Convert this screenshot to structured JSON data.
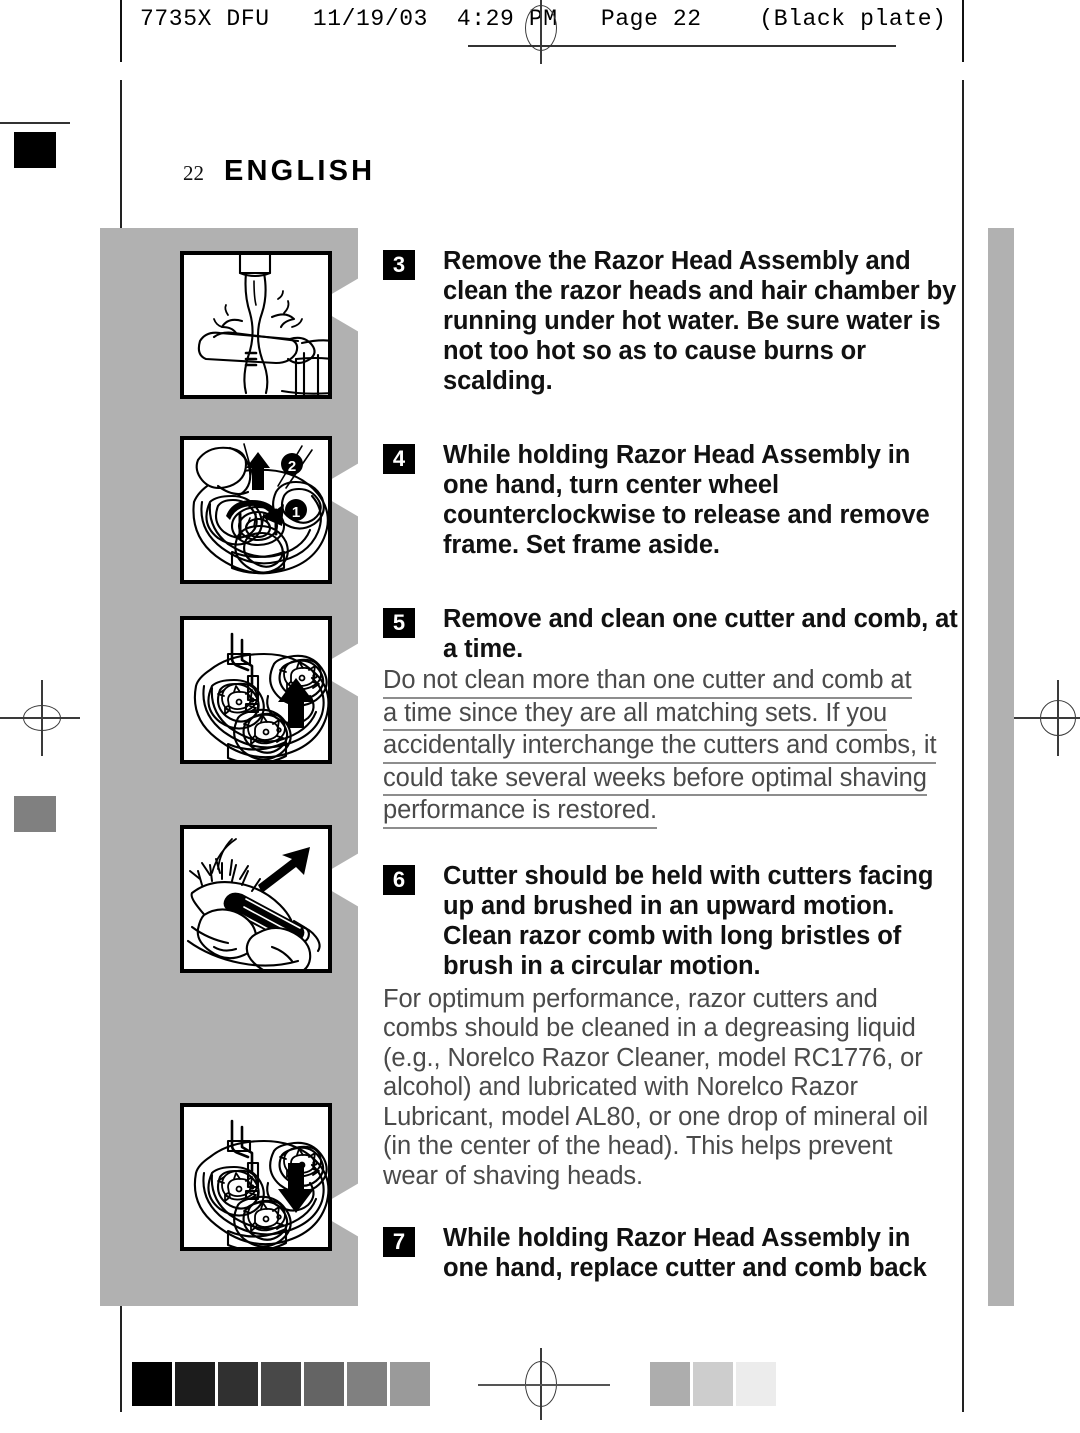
{
  "print_header": {
    "text": "7735X DFU   11/19/03  4:29 PM   Page 22    (Black plate)"
  },
  "page": {
    "folio": "22",
    "language_title": "ENGLISH"
  },
  "steps": [
    {
      "number": "3",
      "emphasis": "bold",
      "text": "Remove the Razor Head Assembly and clean the razor heads and hair chamber by running under hot water. Be sure water is not too hot so as to cause burns or scalding."
    },
    {
      "number": "4",
      "emphasis": "bold",
      "text": "While holding Razor Head Assembly in one hand, turn center wheel counterclockwise to release and remove frame. Set frame aside."
    },
    {
      "number": "5",
      "emphasis": "bold",
      "text": "Remove and clean one cutter and comb, at a time."
    },
    {
      "number": "6",
      "emphasis": "bold",
      "text": "Cutter should be held with cutters facing up and brushed in an upward motion. Clean razor comb with long bristles of brush in a circular motion."
    },
    {
      "number": "7",
      "emphasis": "bold",
      "text": "While holding Razor Head Assembly in one hand, replace cutter and comb back"
    }
  ],
  "step_lines": {
    "s3": [
      "Remove the Razor Head Assembly and",
      "clean the razor heads and hair chamber by",
      "running under hot water. Be sure water is",
      "not too hot so as to cause burns or",
      "scalding."
    ],
    "s4": [
      "While holding Razor Head Assembly in",
      "one hand, turn center wheel",
      "counterclockwise to release and remove",
      "frame. Set frame aside."
    ],
    "s5": [
      "Remove and clean one cutter and comb, at",
      "a time."
    ],
    "s6": [
      "Cutter should be held with cutters facing",
      "up and brushed in an upward motion.",
      "Clean razor comb with long bristles of",
      "brush in a circular motion."
    ],
    "s7": [
      "While holding Razor Head Assembly in",
      "one hand, replace cutter and comb back"
    ]
  },
  "notes": {
    "note_after_5": {
      "style": "gray-underlined",
      "text": "Do not clean more than one cutter and comb at a time since they are all matching sets. If you accidentally interchange the cutters and combs, it could take several weeks before optimal shaving performance is restored.",
      "lines": [
        "Do not clean more than one cutter and comb at",
        "a time since they are all matching sets. If you",
        "accidentally interchange the cutters and combs, it",
        "could take several weeks before optimal shaving",
        "performance is restored."
      ]
    },
    "note_after_6": {
      "style": "gray",
      "text": "For optimum performance, razor cutters and combs should be cleaned in a degreasing liquid (e.g., Norelco Razor Cleaner, model RC1776, or alcohol) and lubricated with Norelco Razor Lubricant, model AL80, or one drop of mineral oil (in the center of the head). This helps prevent wear of shaving heads.",
      "lines": [
        "For optimum performance, razor cutters and",
        "combs should be cleaned in a degreasing liquid",
        "(e.g., Norelco Razor Cleaner, model RC1776, or",
        "alcohol) and lubricated with Norelco Razor",
        "Lubricant, model AL80, or one drop of mineral oil",
        "(in the center of the head). This helps prevent",
        "wear of shaving heads."
      ]
    }
  },
  "figures": [
    {
      "id": "figure-rinsing-razor-head",
      "caption_ref": "3",
      "description": "Razor head rinsed under running tap water",
      "callouts": []
    },
    {
      "id": "figure-turn-center-wheel",
      "caption_ref": "4",
      "description": "Turning center wheel counterclockwise to release frame",
      "callouts": [
        "1",
        "2"
      ]
    },
    {
      "id": "figure-remove-cutter",
      "caption_ref": "5",
      "description": "Razor head with three cutters, upward arrow to remove cutter",
      "callouts": []
    },
    {
      "id": "figure-brush-cutter",
      "caption_ref": "6",
      "description": "Brushing cutter in an upward motion",
      "callouts": []
    },
    {
      "id": "figure-replace-cutter",
      "caption_ref": "7",
      "description": "Razor head with three cutters, downward arrow to replace cutter",
      "callouts": []
    }
  ],
  "colors": {
    "band_gray": "#b1b1b1",
    "note_gray": "#4a4a4a",
    "underline_gray": "#8d8d8d",
    "ink_black": "#000000"
  },
  "calibration": {
    "left_margin_swatches": [
      "#000000",
      "#808080"
    ],
    "bottom_strip_dark": [
      "#000000",
      "#1c1c1c",
      "#303030",
      "#484848",
      "#646464",
      "#808080",
      "#9a9a9a"
    ],
    "bottom_strip_light": [
      "#adadad",
      "#cdcdcd",
      "#ececec"
    ]
  }
}
